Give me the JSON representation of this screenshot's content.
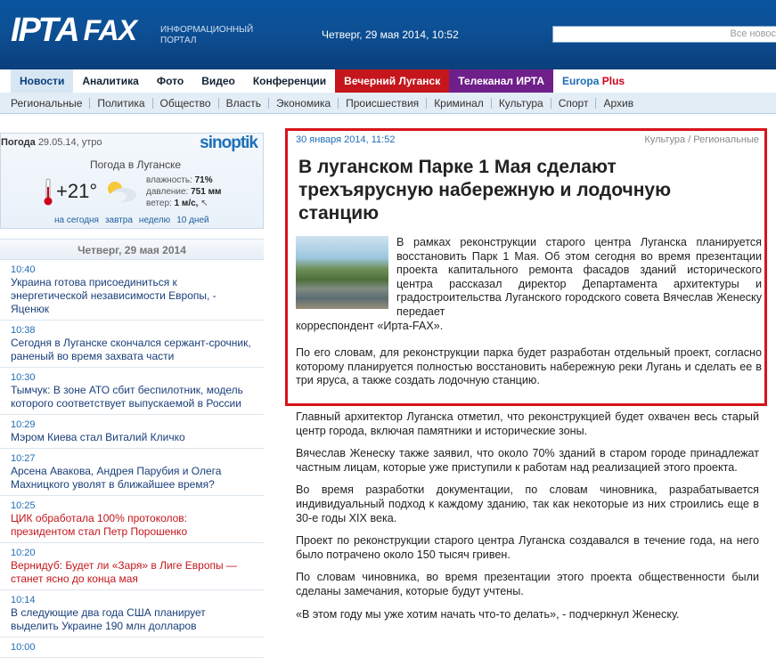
{
  "header": {
    "logo_text": "ІРТА",
    "logo_fax": "FAX",
    "portal_line1": "ИНФОРМАЦИОННЫЙ",
    "portal_line2": "ПОРТАЛ",
    "datetime": "Четверг, 29 мая 2014, 10:52",
    "search_placeholder": "Все новос"
  },
  "topnav": [
    {
      "label": "Новости",
      "style": "active"
    },
    {
      "label": "Аналитика"
    },
    {
      "label": "Фото"
    },
    {
      "label": "Видео"
    },
    {
      "label": "Конференции"
    },
    {
      "label": "Вечерний Луганск",
      "style": "red"
    },
    {
      "label": "Телеканал ИРТА",
      "style": "purple"
    }
  ],
  "europa": {
    "label": "Europa",
    "plus": "Plus"
  },
  "subnav": [
    "Региональные",
    "Политика",
    "Общество",
    "Власть",
    "Экономика",
    "Происшествия",
    "Криминал",
    "Культура",
    "Спорт",
    "Архив"
  ],
  "weather": {
    "label": "Погода",
    "date": "29.05.14, утро",
    "brand": "sinoptik",
    "city": "Погода в Луганске",
    "temp": "+21°",
    "humidity_label": "влажность:",
    "humidity": "71%",
    "pressure_label": "давление:",
    "pressure": "751 мм",
    "wind_label": "ветер:",
    "wind": "1 м/с,",
    "links": [
      "на сегодня",
      "завтра",
      "неделю",
      "10 дней"
    ]
  },
  "news": {
    "date": "Четверг, 29 мая 2014",
    "items": [
      {
        "time": "10:40",
        "title": "Украина готова присоединиться к энергетической независимости Европы, - Яценюк",
        "red": false
      },
      {
        "time": "10:38",
        "title": "Сегодня в Луганске скончался сержант-срочник, раненый во время захвата части",
        "red": false
      },
      {
        "time": "10:30",
        "title": "Тымчук: В зоне АТО сбит беспилотник, модель которого соответствует выпускаемой в России",
        "red": false
      },
      {
        "time": "10:29",
        "title": "Мэром Киева стал Виталий Кличко",
        "red": false
      },
      {
        "time": "10:27",
        "title": "Арсена Авакова, Андрея Парубия и Олега Махницкого уволят в ближайшее время?",
        "red": false
      },
      {
        "time": "10:25",
        "title": "ЦИК обработала 100% протоколов: президентом стал Петр Порошенко",
        "red": true
      },
      {
        "time": "10:20",
        "title": "Вернидуб: Будет ли «Заря» в Лиге Европы — станет ясно до конца мая",
        "red": true
      },
      {
        "time": "10:14",
        "title": "В следующие два года США планирует выделить Украине 190 млн долларов",
        "red": false
      },
      {
        "time": "10:00",
        "title": "",
        "red": false
      }
    ]
  },
  "article": {
    "date": "30 января 2014, 11:52",
    "category": "Культура / Региональные",
    "title": "В луганском Парке 1 Мая сделают трехъярусную набережную и лодочную станцию",
    "lead": "В рамках реконструкции старого центра Луганска планируется восстановить Парк 1 Мая. Об этом сегодня во время презентации проекта капитального ремонта фасадов зданий исторического центра рассказал директор Департамента архитектуры и градостроительства Луганского городского совета Вячеслав Женеску передает",
    "lead_tail": "корреспондент «Ирта-FAX».",
    "p2": "По его словам, для реконструкции парка будет разработан отдельный проект, согласно которому планируется полностью восстановить набережную реки Лугань и сделать ее в три яруса, а также создать лодочную станцию.",
    "body": [
      "Главный архитектор Луганска отметил, что реконструкцией будет охвачен весь старый центр города, включая памятники и исторические зоны.",
      "Вячеслав Женеску также заявил, что около 70% зданий в старом городе принадлежат частным лицам, которые уже приступили к работам над реализацией этого проекта.",
      "Во время разработки документации, по словам чиновника, разрабатывается индивидуальный подход к каждому зданию, так как некоторые из них строились еще в 30-е годы XIX века.",
      "Проект по реконструкции старого центра Луганска создавался в течение года, на него было потрачено около 150 тысяч гривен.",
      "По словам чиновника, во время презентации этого проекта общественности были сделаны замечания, которые будут учтены.",
      "«В этом году мы уже хотим начать что-то делать», - подчеркнул Женеску."
    ]
  }
}
